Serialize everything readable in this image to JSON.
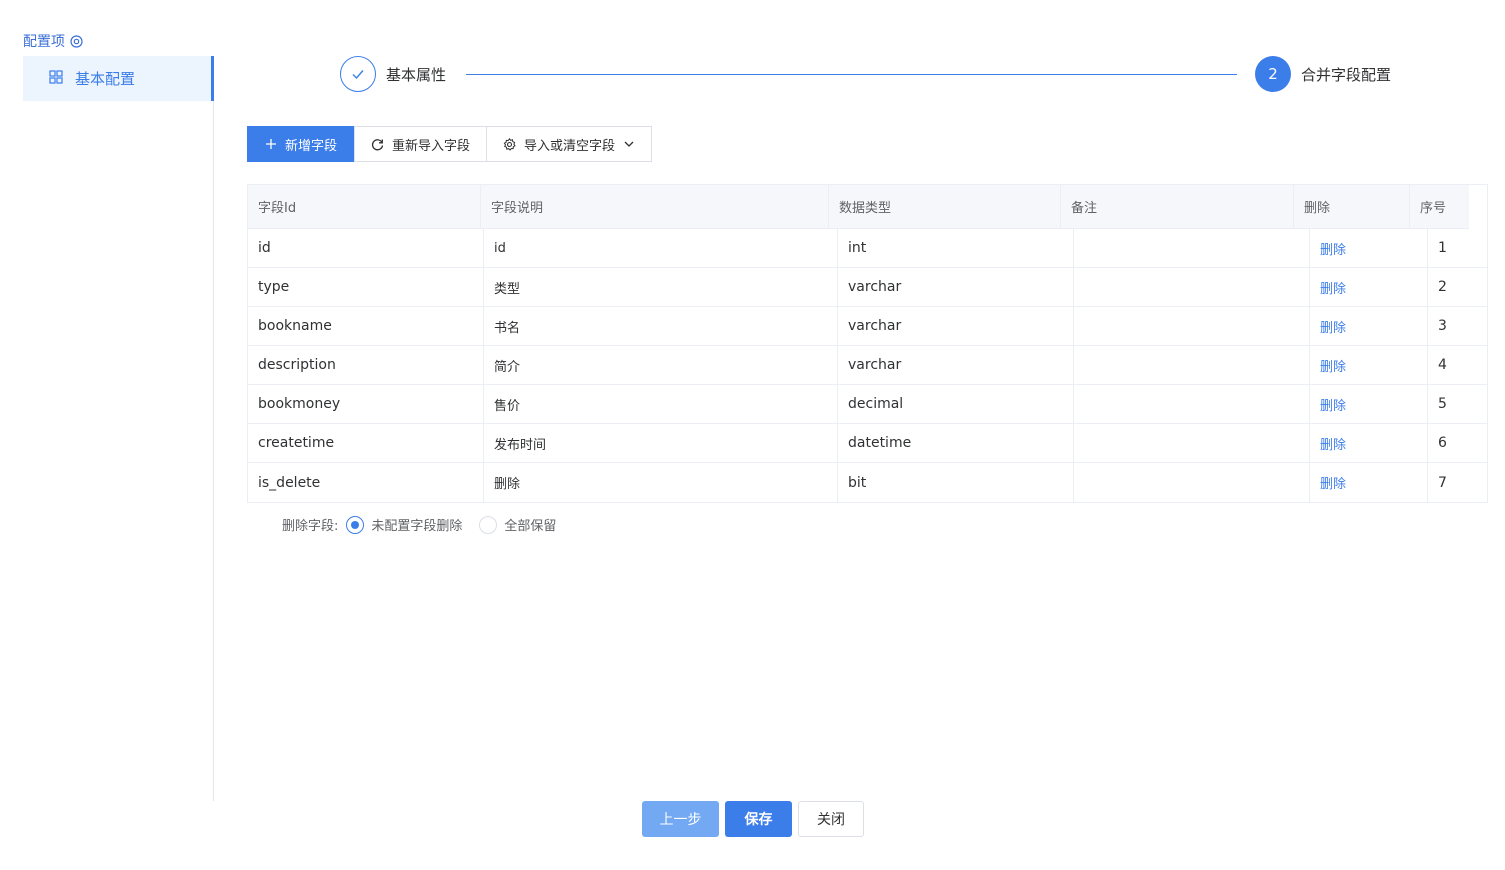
{
  "sidebar": {
    "title": "配置项",
    "items": [
      {
        "label": "基本配置",
        "active": true
      }
    ]
  },
  "steps": [
    {
      "label": "基本属性",
      "status": "done"
    },
    {
      "number": "2",
      "label": "合并字段配置",
      "status": "active"
    }
  ],
  "toolbar": {
    "add_label": "新增字段",
    "reimport_label": "重新导入字段",
    "import_clear_label": "导入或清空字段"
  },
  "table": {
    "columns": [
      "字段Id",
      "字段说明",
      "数据类型",
      "备注",
      "删除",
      "序号"
    ],
    "rows": [
      {
        "field_id": "id",
        "desc": "id",
        "type": "int",
        "remark": "",
        "delete": "删除",
        "index": "1"
      },
      {
        "field_id": "type",
        "desc": "类型",
        "type": "varchar",
        "remark": "",
        "delete": "删除",
        "index": "2"
      },
      {
        "field_id": "bookname",
        "desc": "书名",
        "type": "varchar",
        "remark": "",
        "delete": "删除",
        "index": "3"
      },
      {
        "field_id": "description",
        "desc": "简介",
        "type": "varchar",
        "remark": "",
        "delete": "删除",
        "index": "4"
      },
      {
        "field_id": "bookmoney",
        "desc": "售价",
        "type": "decimal",
        "remark": "",
        "delete": "删除",
        "index": "5"
      },
      {
        "field_id": "createtime",
        "desc": "发布时间",
        "type": "datetime",
        "remark": "",
        "delete": "删除",
        "index": "6"
      },
      {
        "field_id": "is_delete",
        "desc": "删除",
        "type": "bit",
        "remark": "",
        "delete": "删除",
        "index": "7"
      }
    ]
  },
  "delete_fields": {
    "label": "删除字段:",
    "options": [
      {
        "label": "未配置字段删除",
        "checked": true
      },
      {
        "label": "全部保留",
        "checked": false
      }
    ]
  },
  "footer": {
    "prev_label": "上一步",
    "save_label": "保存",
    "close_label": "关闭"
  },
  "colors": {
    "primary": "#3b7de9",
    "primary_light": "#73a8f3",
    "sidebar_active_bg": "#ecf4fe"
  }
}
